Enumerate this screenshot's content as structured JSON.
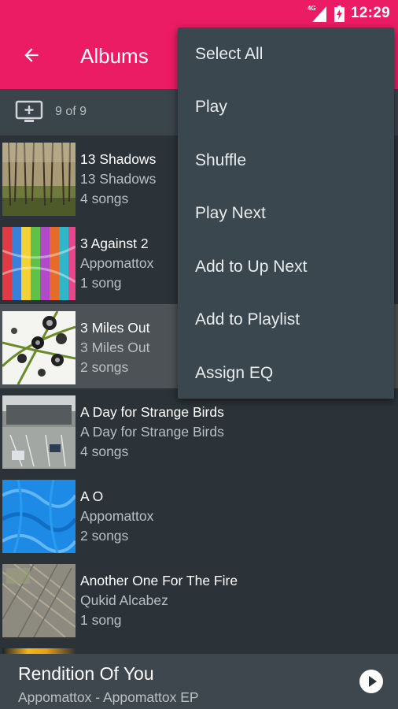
{
  "status_bar": {
    "network": "4G",
    "time": "12:29"
  },
  "toolbar": {
    "title": "Albums",
    "back_icon": "arrow-back-icon"
  },
  "subbar": {
    "cast_icon": "cast-screen-icon",
    "count": "9 of 9"
  },
  "albums": [
    {
      "title": "13 Shadows",
      "artist": "13 Shadows",
      "songs": "4 songs",
      "art": "forest-trees"
    },
    {
      "title": "3 Against 2",
      "artist": "Appomattox",
      "songs": "1 song",
      "art": "rainbow-fabric"
    },
    {
      "title": "3 Miles Out",
      "artist": "3 Miles Out",
      "songs": "2 songs",
      "art": "tree-circles"
    },
    {
      "title": "A Day for Strange Birds",
      "artist": "A Day for Strange Birds",
      "songs": "4 songs",
      "art": "parking-lot"
    },
    {
      "title": "A O",
      "artist": "Appomattox",
      "songs": "2 songs",
      "art": "blue-texture"
    },
    {
      "title": "Another One For The Fire",
      "artist": "Qukid Alcabez",
      "songs": "1 song",
      "art": "aerial-fields"
    }
  ],
  "menu": {
    "items": [
      "Select All",
      "Play",
      "Shuffle",
      "Play Next",
      "Add to Up Next",
      "Add to Playlist",
      "Assign EQ"
    ]
  },
  "now_playing": {
    "title": "Rendition Of You",
    "subtitle": "Appomattox - Appomattox EP",
    "play_icon": "play-icon"
  },
  "colors": {
    "accent": "#ec1c64",
    "background": "#2b3338",
    "menu": "#3a474e"
  }
}
